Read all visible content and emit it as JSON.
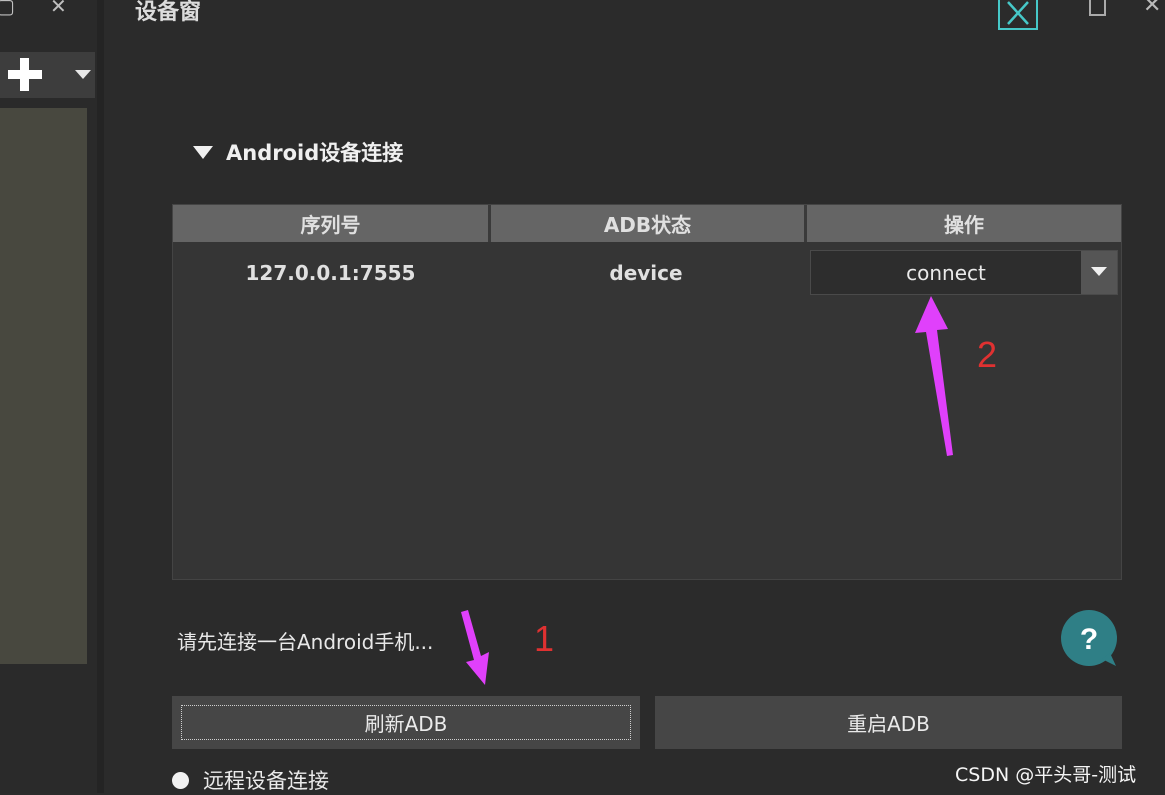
{
  "window": {
    "title": "设备窗"
  },
  "left_strip": {
    "restore_glyph": "▢",
    "close_glyph": "✕",
    "add_glyph": "+"
  },
  "section": {
    "title": "Android设备连接",
    "expanded": true
  },
  "table": {
    "headers": [
      "序列号",
      "ADB状态",
      "操作"
    ],
    "rows": [
      {
        "serial": "127.0.0.1:7555",
        "adb_status": "device",
        "action": "connect"
      }
    ]
  },
  "hint": "请先连接一台Android手机...",
  "help": {
    "icon": "help-bubble-icon",
    "glyph": "?",
    "color": "#2f7f86"
  },
  "buttons": {
    "refresh_adb": "刷新ADB",
    "restart_adb": "重启ADB"
  },
  "remote": {
    "label": "远程设备连接"
  },
  "annotations": {
    "step1": "1",
    "step2": "2",
    "number_color": "#e03131",
    "arrow_color": "#e040fb"
  },
  "watermark": "CSDN @平头哥-测试",
  "colors": {
    "background": "#2b2b2b",
    "header_bg": "#656565",
    "button_bg": "#464646",
    "accent_cyan": "#46c8c8"
  }
}
